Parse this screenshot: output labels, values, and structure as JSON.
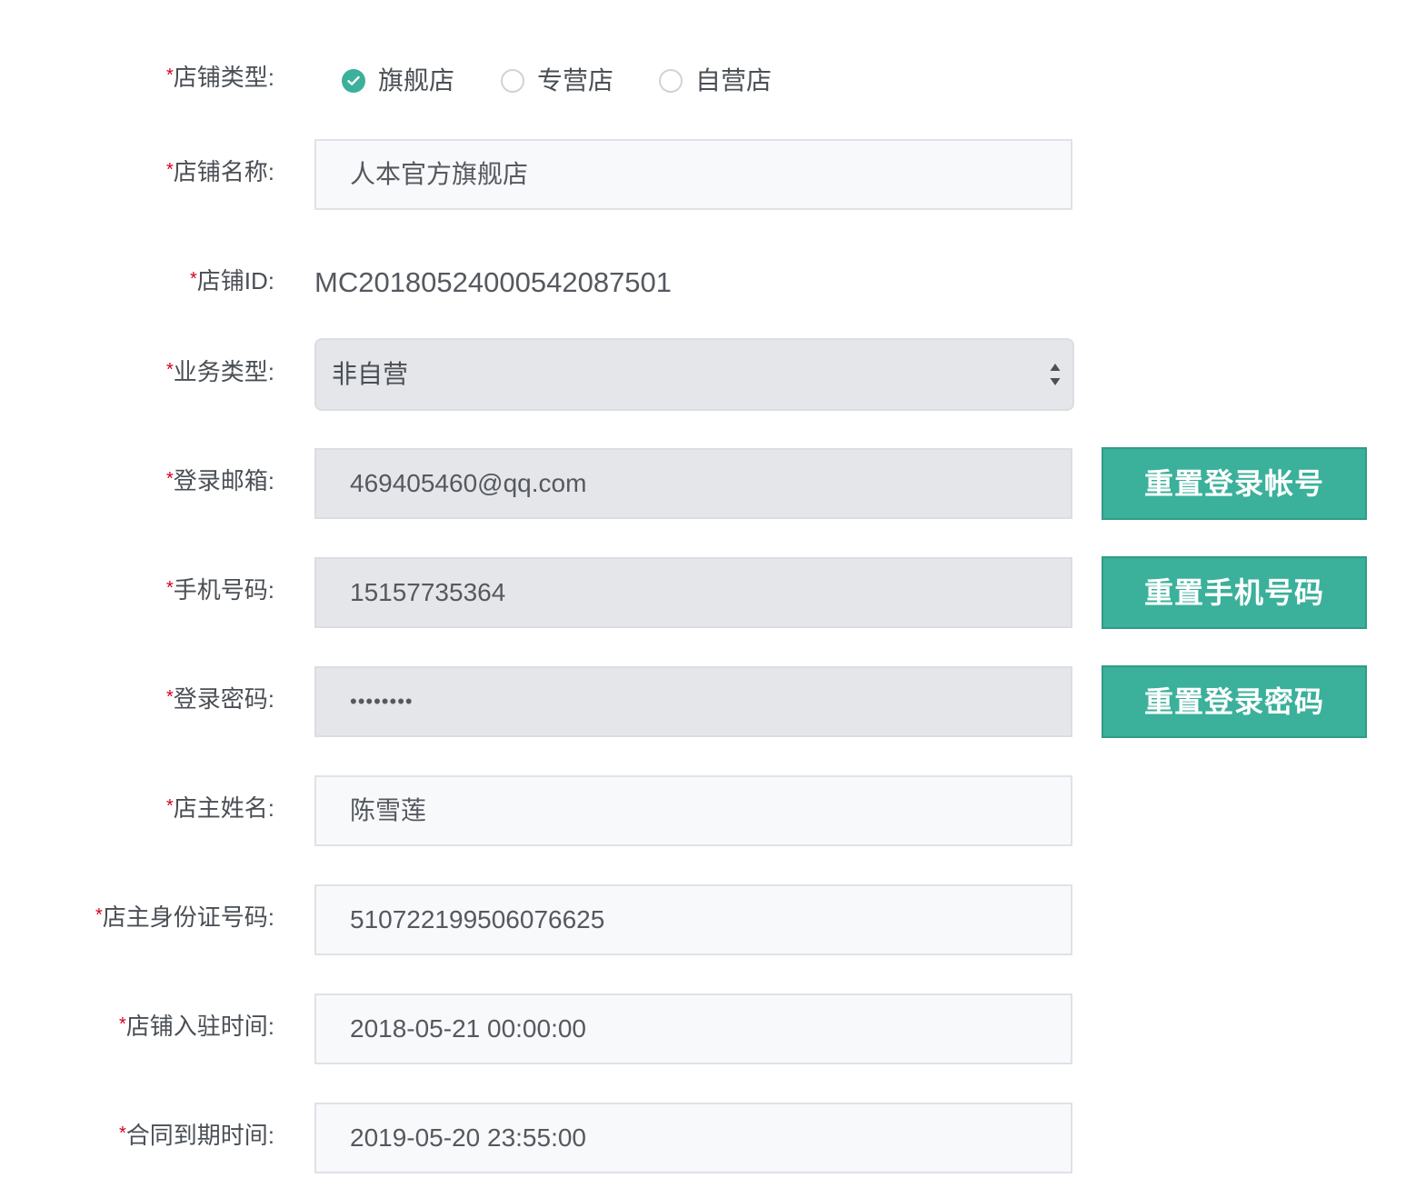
{
  "form": {
    "store_type": {
      "required_mark": "*",
      "label": "店铺类型:",
      "options": [
        {
          "label": "旗舰店",
          "checked": true
        },
        {
          "label": "专营店",
          "checked": false
        },
        {
          "label": "自营店",
          "checked": false
        }
      ]
    },
    "store_name": {
      "required_mark": "*",
      "label": "店铺名称:",
      "value": "人本官方旗舰店"
    },
    "store_id": {
      "required_mark": "*",
      "label": "店铺ID:",
      "value": "MC2018052400054208750​1"
    },
    "business_type": {
      "required_mark": "*",
      "label": "业务类型:",
      "value": "非自营"
    },
    "login_email": {
      "required_mark": "*",
      "label": "登录邮箱:",
      "value": "469405460@qq.com",
      "button_label": "重置登录帐号"
    },
    "phone": {
      "required_mark": "*",
      "label": "手机号码:",
      "value": "15157735364",
      "button_label": "重置手机号码"
    },
    "password": {
      "required_mark": "*",
      "label": "登录密码:",
      "value": "••••••••",
      "button_label": "重置登录密码"
    },
    "owner_name": {
      "required_mark": "*",
      "label": "店主姓名:",
      "value": "陈雪莲"
    },
    "owner_id_card": {
      "required_mark": "*",
      "label": "店主身份证号码:",
      "value": "510722199506076625"
    },
    "settle_time": {
      "required_mark": "*",
      "label": "店铺入驻时间:",
      "value": "2018-05-21 00:00:00"
    },
    "contract_expire": {
      "required_mark": "*",
      "label": "合同到期时间:",
      "value": "2019-05-20 23:55:00"
    }
  },
  "colors": {
    "accent": "#3bb09a",
    "required": "#d0021b",
    "disabled_bg": "#e4e6ea",
    "input_bg": "#f8f9fb"
  }
}
